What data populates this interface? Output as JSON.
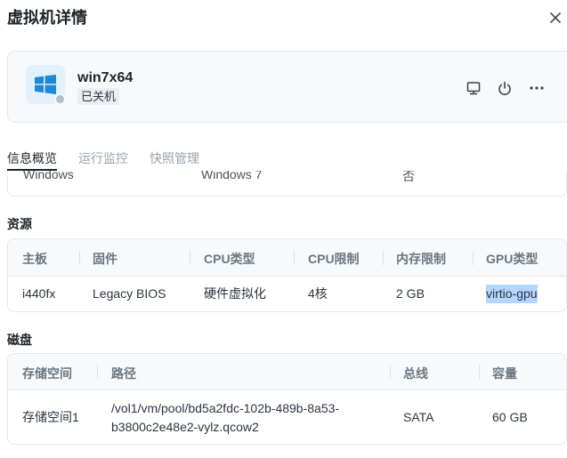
{
  "dialog": {
    "title": "虚拟机详情"
  },
  "vm": {
    "name": "win7x64",
    "status": "已关机"
  },
  "tabs": [
    {
      "label": "信息概览",
      "active": true
    },
    {
      "label": "运行监控",
      "active": false
    },
    {
      "label": "快照管理",
      "active": false
    }
  ],
  "overview_partial": {
    "cells": [
      "Windows",
      "Windows 7",
      "否"
    ]
  },
  "resources": {
    "title": "资源",
    "headers": [
      "主板",
      "固件",
      "CPU类型",
      "CPU限制",
      "内存限制",
      "GPU类型"
    ],
    "row": [
      "i440fx",
      "Legacy BIOS",
      "硬件虚拟化",
      "4核",
      "2 GB",
      "virtio-gpu"
    ]
  },
  "disks": {
    "title": "磁盘",
    "headers": [
      "存储空间",
      "路径",
      "总线",
      "容量"
    ],
    "row": {
      "storage": "存储空间1",
      "path_line1": "/vol1/vm/pool/bd5a2fdc-102b-489b-8a53-",
      "path_line2": "b3800c2e48e2-vylz.qcow2",
      "bus": "SATA",
      "capacity": "60 GB"
    }
  },
  "icons": {
    "close": "close-icon",
    "os": "windows-logo-icon",
    "console": "monitor-icon",
    "power": "power-icon",
    "more": "more-icon"
  },
  "colors": {
    "card_bg": "#f7f9fb",
    "border": "#e4e8ee",
    "windows_blue": "#1e88d8",
    "status_off": "#b6bcc4",
    "selection": "#b4d5fe"
  }
}
